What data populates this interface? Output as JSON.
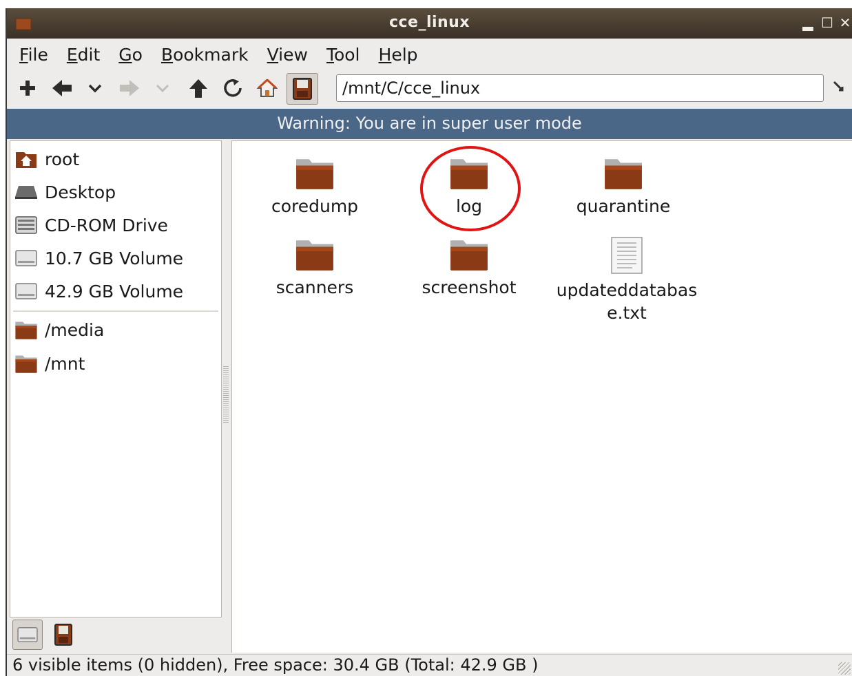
{
  "window": {
    "title": "cce_linux",
    "minimize_glyph": "▂",
    "maximize_glyph": "☐",
    "close_glyph": "✕"
  },
  "menu": [
    {
      "mnemonic": "F",
      "rest": "ile"
    },
    {
      "mnemonic": "E",
      "rest": "dit"
    },
    {
      "mnemonic": "G",
      "rest": "o"
    },
    {
      "mnemonic": "B",
      "rest": "ookmark"
    },
    {
      "mnemonic": "V",
      "rest": "iew"
    },
    {
      "mnemonic": "T",
      "rest": "ool"
    },
    {
      "mnemonic": "H",
      "rest": "elp"
    }
  ],
  "toolbar": {
    "icons": [
      "new-tab-icon",
      "back-icon",
      "back-history-icon",
      "forward-icon",
      "forward-history-icon",
      "up-icon",
      "reload-icon",
      "home-icon",
      "super-user-icon"
    ],
    "path": "/mnt/C/cce_linux"
  },
  "warning": "Warning: You are in super user mode",
  "sidebar": {
    "places": [
      "root",
      "Desktop",
      "CD-ROM Drive",
      "10.7 GB Volume",
      "42.9 GB Volume"
    ],
    "bookmarks": [
      "/media",
      "/mnt"
    ]
  },
  "files": [
    {
      "name": "coredump",
      "type": "folder"
    },
    {
      "name": "log",
      "type": "folder"
    },
    {
      "name": "quarantine",
      "type": "folder"
    },
    {
      "name": "scanners",
      "type": "folder"
    },
    {
      "name": "screenshot",
      "type": "folder"
    },
    {
      "name": "updateddatabase.txt",
      "type": "text-file"
    }
  ],
  "status": "6 visible items (0 hidden), Free space: 30.4 GB (Total: 42.9 GB )",
  "colors": {
    "folder": "#8a3a14",
    "warning_bg": "#4b6787",
    "highlight": "#e01414"
  }
}
